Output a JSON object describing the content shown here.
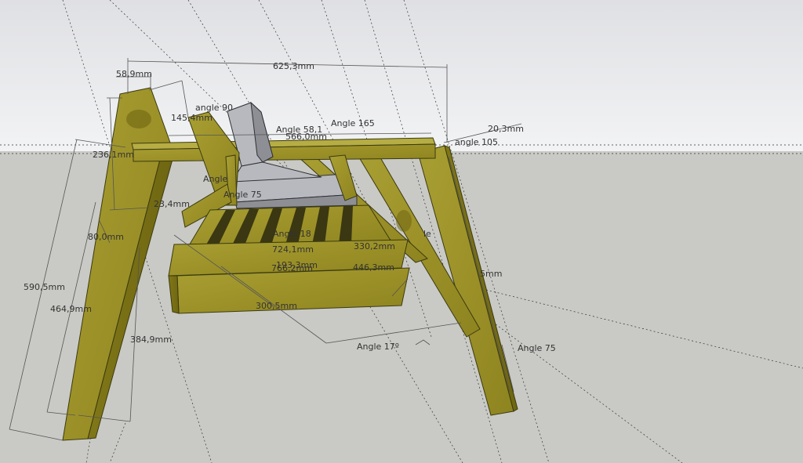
{
  "dimensions": {
    "d_625": "625,3mm",
    "d_58": "58,9mm",
    "d_145": "145,4mm",
    "d_566": "566,0mm",
    "d_20": "20,3mm",
    "d_236": "236,1mm",
    "d_23": "23,4mm",
    "d_80": "80,0mm",
    "d_724": "724,1mm",
    "d_330": "330,2mm",
    "d_193": "193,3mm",
    "d_766": "766,2mm",
    "d_446": "446,3mm",
    "d_300": "300,5mm",
    "d_590": "590,5mm",
    "d_464": "464,9mm",
    "d_384": "384,9mm",
    "d_5": "5mm"
  },
  "angles": {
    "a_90": "angle 90",
    "a_58": "Angle 58,1",
    "a_165": "Angle 165",
    "a_105": "angle 105",
    "a_75a": "Angle 75",
    "a_18": "Angle 18",
    "a_le": "le",
    "a_17": "Angle 17º",
    "a_75b": "Angle 75"
  },
  "colors": {
    "sky": "#e9eaed",
    "ground": "#c9c9c5",
    "wood": "#a39a2f",
    "cushion": "#8d8f95"
  }
}
